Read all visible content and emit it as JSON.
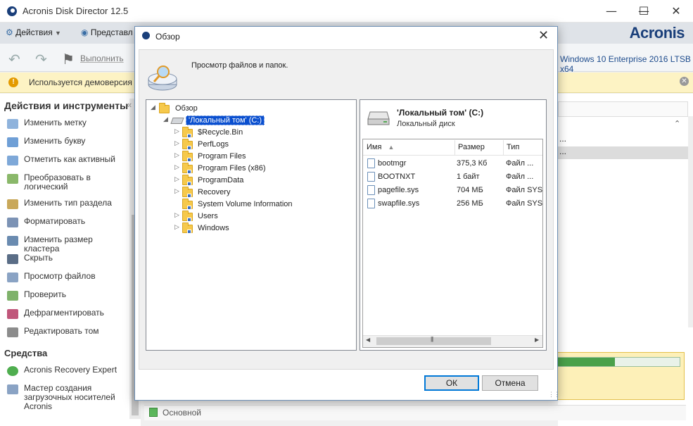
{
  "app": {
    "title": "Acronis Disk Director 12.5",
    "brand": "Acronis",
    "menu_actions": "Действия",
    "menu_view": "Представл",
    "run_label": "Выполнить",
    "os_label": "Windows 10 Enterprise 2016 LTSB x64",
    "demo_text": "Используется демоверсия Ac"
  },
  "sidebar": {
    "tools_heading": "Действия и инструменты",
    "tools": [
      {
        "label": "Изменить метку",
        "icon": "label-icon"
      },
      {
        "label": "Изменить букву",
        "icon": "letter-icon"
      },
      {
        "label": "Отметить как активный",
        "icon": "active-icon"
      },
      {
        "label": "Преобразовать в логический",
        "icon": "convert-icon"
      },
      {
        "label": "Изменить тип раздела",
        "icon": "partition-type-icon"
      },
      {
        "label": "Форматировать",
        "icon": "format-icon"
      },
      {
        "label": "Изменить размер кластера",
        "icon": "cluster-icon"
      },
      {
        "label": "Скрыть",
        "icon": "hide-icon"
      },
      {
        "label": "Просмотр файлов",
        "icon": "browse-icon"
      },
      {
        "label": "Проверить",
        "icon": "check-icon"
      },
      {
        "label": "Дефрагментировать",
        "icon": "defrag-icon"
      },
      {
        "label": "Редактировать том",
        "icon": "edit-volume-icon"
      }
    ],
    "means_heading": "Средства",
    "means": [
      {
        "label": "Acronis Recovery Expert",
        "icon": "recovery-icon"
      },
      {
        "label": "Мастер создания загрузочных носителей Acronis",
        "icon": "media-builder-icon"
      }
    ]
  },
  "background": {
    "row1": "...",
    "row2": "...",
    "status": "Основной",
    "usage_fraction": 0.47
  },
  "dialog": {
    "title": "Обзор",
    "description": "Просмотр файлов и папок.",
    "tree": {
      "root": "Обзор",
      "drive": "'Локальный том' (C:)",
      "folders": [
        "$Recycle.Bin",
        "PerfLogs",
        "Program Files",
        "Program Files (x86)",
        "ProgramData",
        "Recovery",
        "System Volume Information",
        "Users",
        "Windows"
      ]
    },
    "drive_name": "'Локальный том' (C:)",
    "drive_type": "Локальный диск",
    "columns": {
      "name": "Имя",
      "size": "Размер",
      "type": "Тип"
    },
    "files": [
      {
        "name": "bootmgr",
        "size": "375,3 Кб",
        "type": "Файл ..."
      },
      {
        "name": "BOOTNXT",
        "size": "1 байт",
        "type": "Файл ..."
      },
      {
        "name": "pagefile.sys",
        "size": "704 МБ",
        "type": "Файл SYS"
      },
      {
        "name": "swapfile.sys",
        "size": "256 МБ",
        "type": "Файл SYS"
      }
    ],
    "ok_label": "ОК",
    "cancel_label": "Отмена"
  },
  "colors": {
    "brand": "#1a3f7a",
    "selection": "#0a4fcf",
    "demo_bar": "#fdf3c4",
    "usage_fill": "#4aa14a"
  }
}
